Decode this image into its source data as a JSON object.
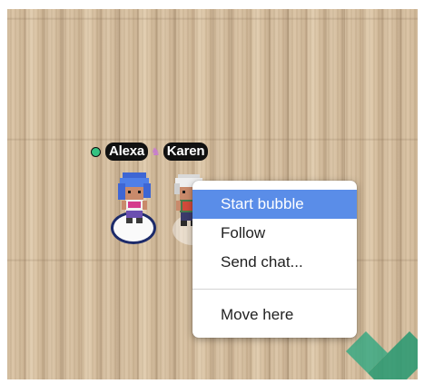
{
  "players": {
    "self_name": "Alexa",
    "other_name": "Karen",
    "status_color": "#35c281",
    "separator_icon": "unicorn-icon"
  },
  "context_menu": {
    "items": [
      {
        "label": "Start bubble",
        "active": true
      },
      {
        "label": "Follow"
      },
      {
        "label": "Send chat..."
      },
      {
        "label": "Move here"
      }
    ],
    "highlight_color": "#5a8de8"
  },
  "logo": {
    "icon": "checkmark-logo-icon",
    "color": "#3aa882"
  }
}
